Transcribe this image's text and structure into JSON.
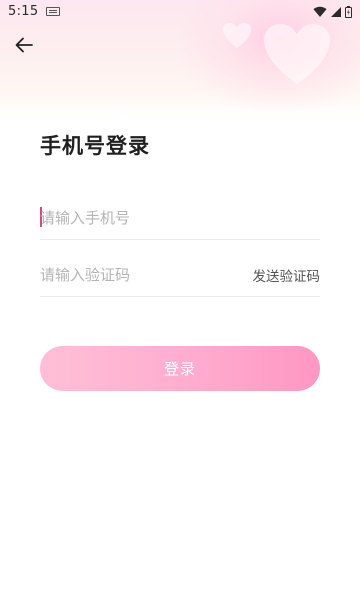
{
  "status_bar": {
    "time": "5:15",
    "icons": [
      "keyboard-icon",
      "wifi-icon",
      "signal-icon",
      "battery-icon"
    ]
  },
  "header": {
    "back_icon": "arrow-left-icon"
  },
  "login": {
    "title": "手机号登录",
    "phone_placeholder": "请输入手机号",
    "code_placeholder": "请输入验证码",
    "send_code_label": "发送验证码",
    "submit_label": "登录"
  },
  "colors": {
    "accent_caret": "#d9477b",
    "button_gradient_start": "#ffbfd6",
    "button_gradient_end": "#ff97c2",
    "header_tint": "#fde7f0"
  }
}
